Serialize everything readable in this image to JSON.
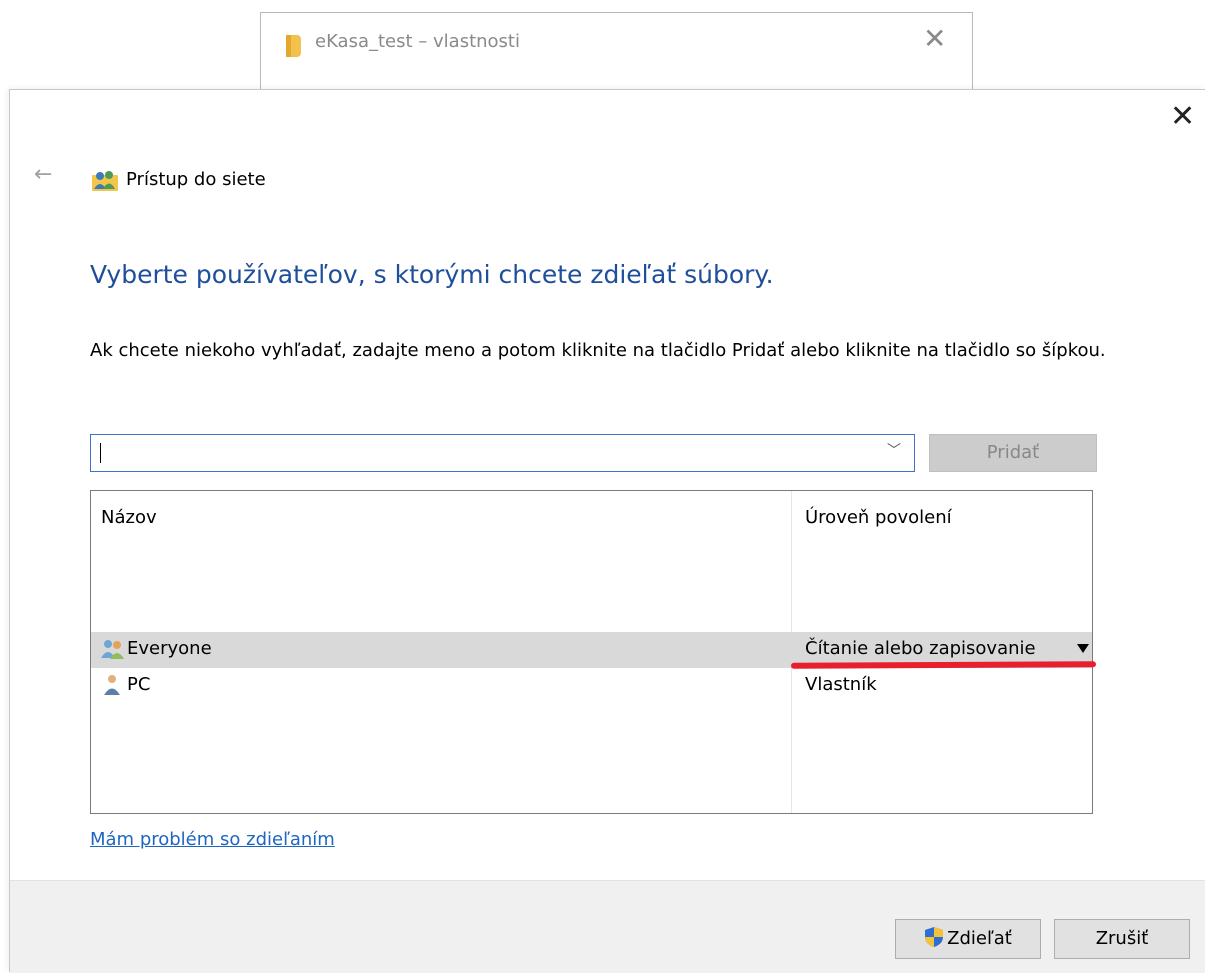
{
  "background_window": {
    "title": "eKasa_test – vlastnosti",
    "close_label": "✕"
  },
  "dialog": {
    "close_label": "✕",
    "back_label": "←",
    "header_title": "Prístup do siete",
    "heading": "Vyberte používateľov, s ktorými chcete zdieľať súbory.",
    "instructions": "Ak chcete niekoho vyhľadať, zadajte meno a potom kliknite na tlačidlo Pridať alebo kliknite na tlačidlo so šípkou.",
    "name_input": {
      "value": "",
      "placeholder": ""
    },
    "add_label": "Pridať",
    "table": {
      "col_name": "Názov",
      "col_permission": "Úroveň povolení",
      "rows": [
        {
          "name": "Everyone",
          "permission": "Čítanie alebo zapisovanie",
          "icon": "group-icon",
          "selected": true
        },
        {
          "name": "PC",
          "permission": "Vlastník",
          "icon": "user-icon",
          "selected": false
        }
      ]
    },
    "help_link": "Mám problém so zdieľaním",
    "share_label": "Zdieľať",
    "cancel_label": "Zrušiť"
  },
  "colors": {
    "heading": "#1f4e9b",
    "link": "#1f66c2",
    "selection": "#d9d9d9",
    "annotation_underline": "#e81f2d"
  }
}
